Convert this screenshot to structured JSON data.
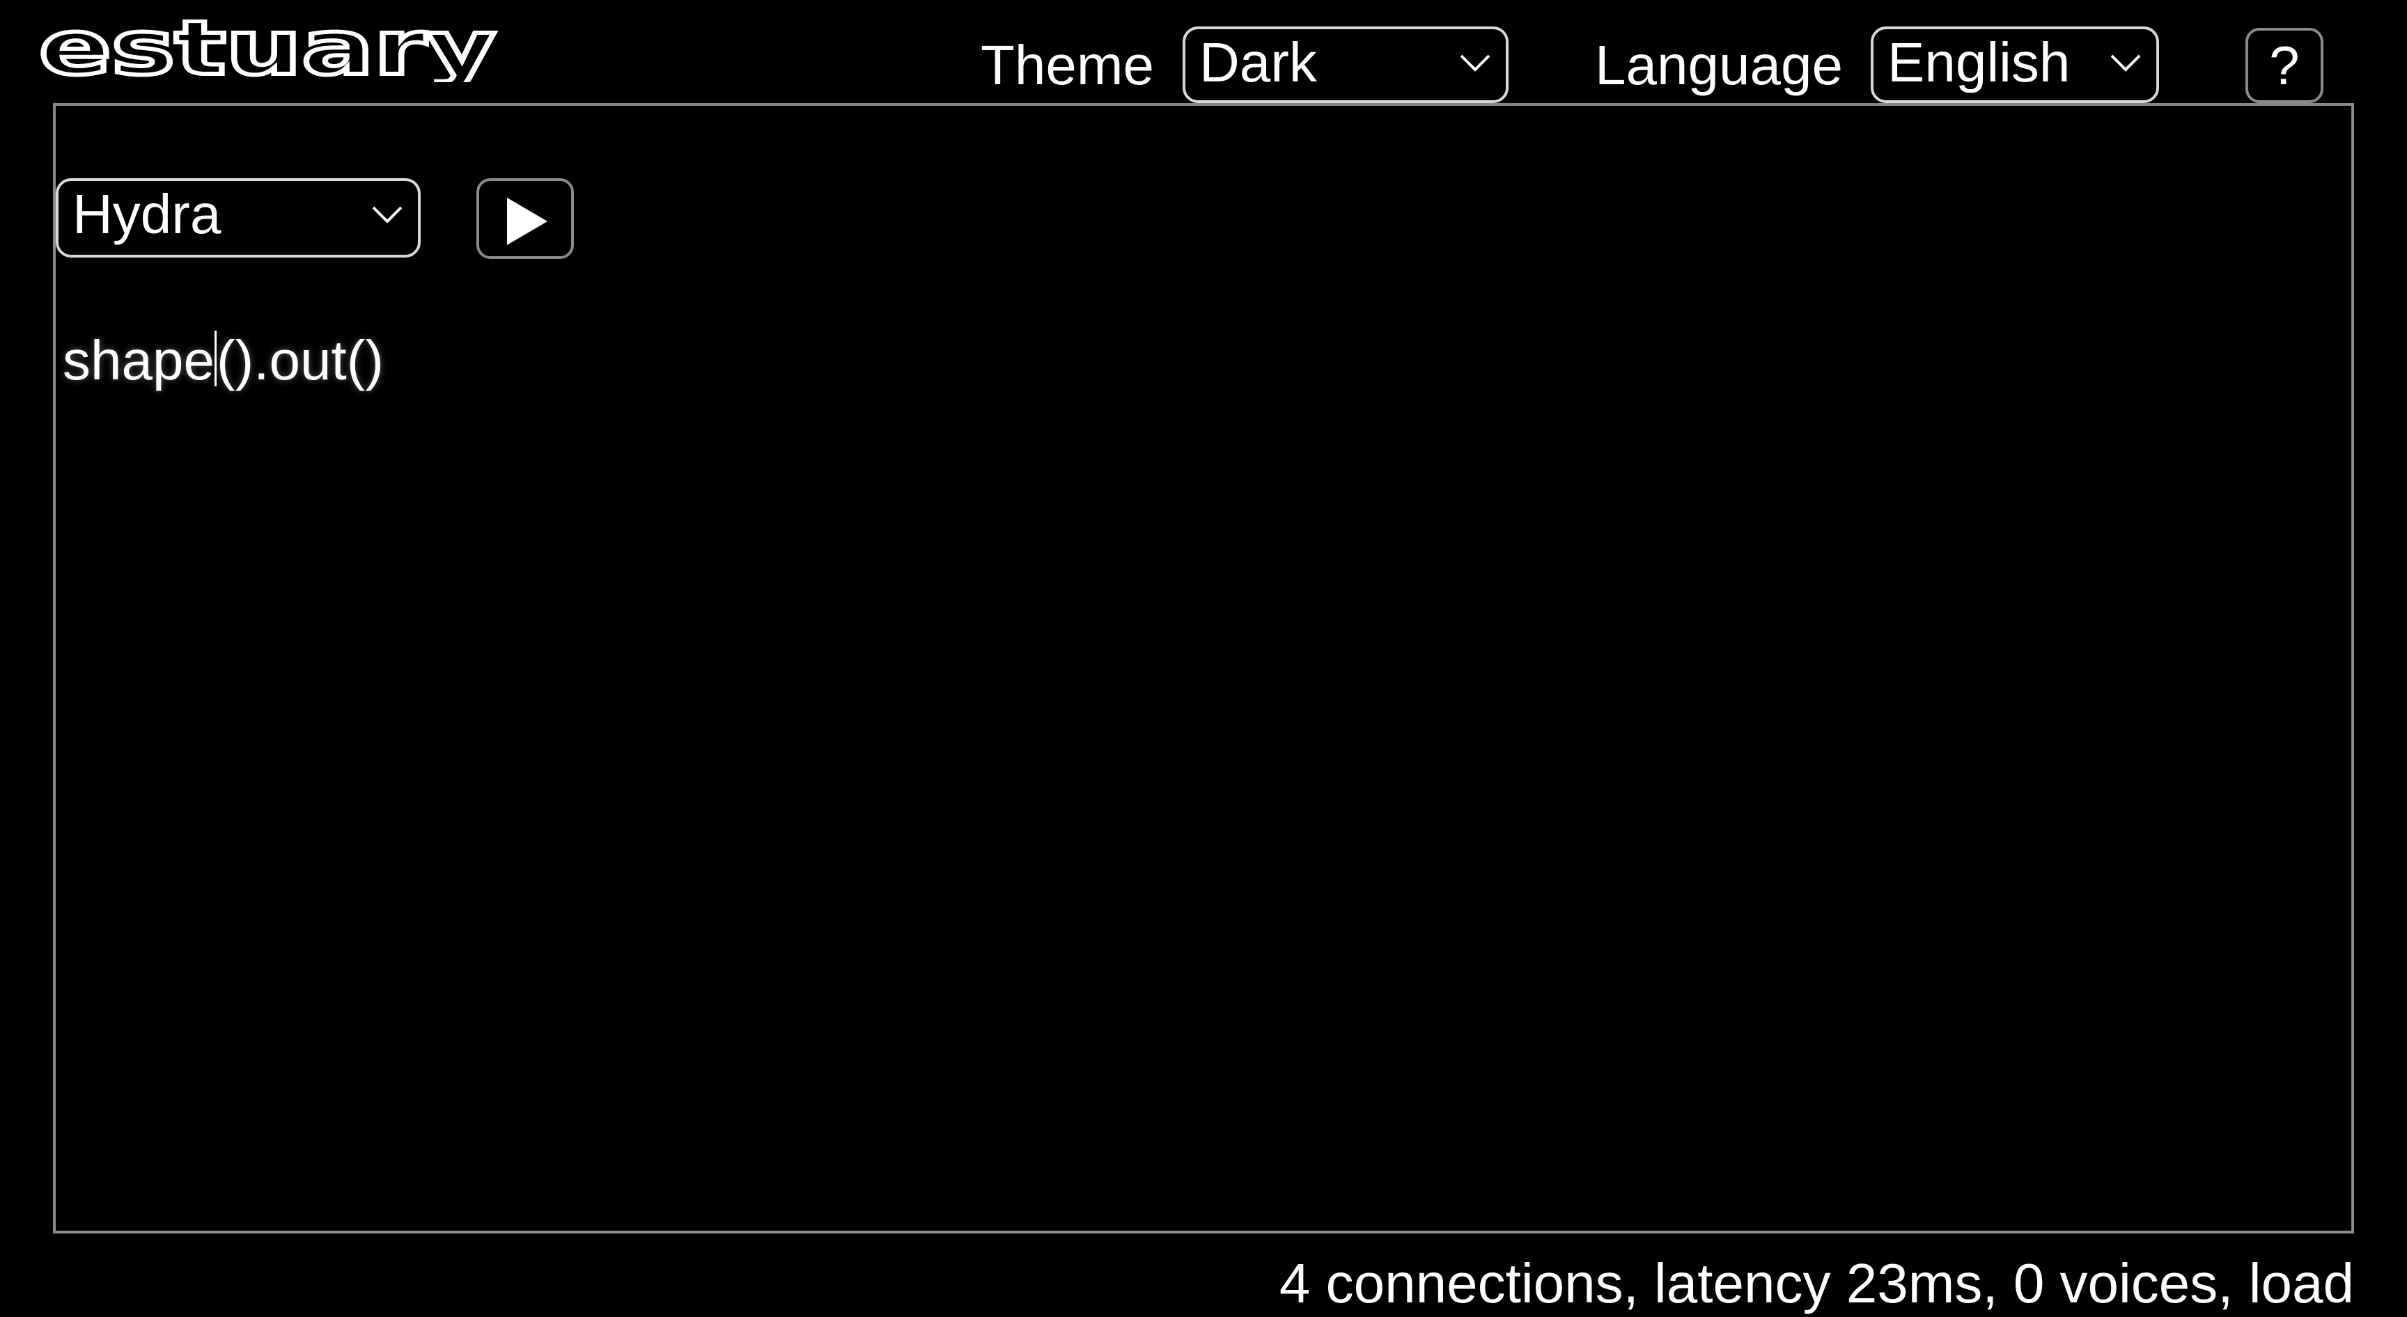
{
  "header": {
    "logo_text": "estuary",
    "theme_label": "Theme",
    "theme_value": "Dark",
    "language_label": "Language",
    "language_value": "English",
    "help_label": "?"
  },
  "editor": {
    "language_value": "Hydra",
    "code_before_caret": "shape",
    "code_after_caret": "().out()"
  },
  "status": {
    "text": "4 connections, latency 23ms, 0 voices, load"
  },
  "icons": {
    "dropdown": "chevron-down-icon",
    "play": "play-icon"
  },
  "colors": {
    "background": "#000000",
    "foreground": "#ffffff",
    "border": "#8a8a8a"
  }
}
